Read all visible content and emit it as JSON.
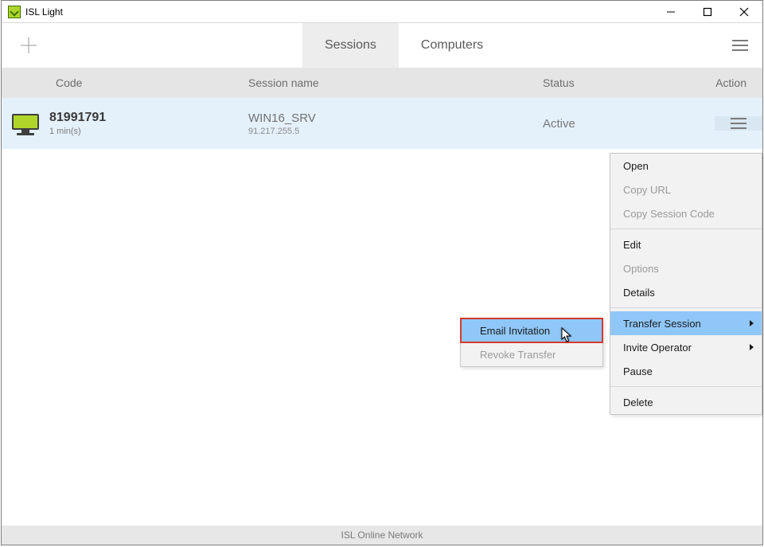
{
  "titlebar": {
    "title": "ISL Light"
  },
  "tabs": {
    "sessions": "Sessions",
    "computers": "Computers"
  },
  "columns": {
    "code": "Code",
    "name": "Session name",
    "status": "Status",
    "action": "Action"
  },
  "row": {
    "code": "81991791",
    "age": "1 min(s)",
    "name": "WIN16_SRV",
    "ip": "91.217.255.5",
    "status": "Active"
  },
  "ctx": {
    "open": "Open",
    "copy_url": "Copy URL",
    "copy_code": "Copy Session Code",
    "edit": "Edit",
    "options": "Options",
    "details": "Details",
    "transfer": "Transfer Session",
    "invite": "Invite Operator",
    "pause": "Pause",
    "delete": "Delete"
  },
  "subctx": {
    "email": "Email Invitation",
    "revoke": "Revoke Transfer"
  },
  "statusbar": "ISL Online Network"
}
